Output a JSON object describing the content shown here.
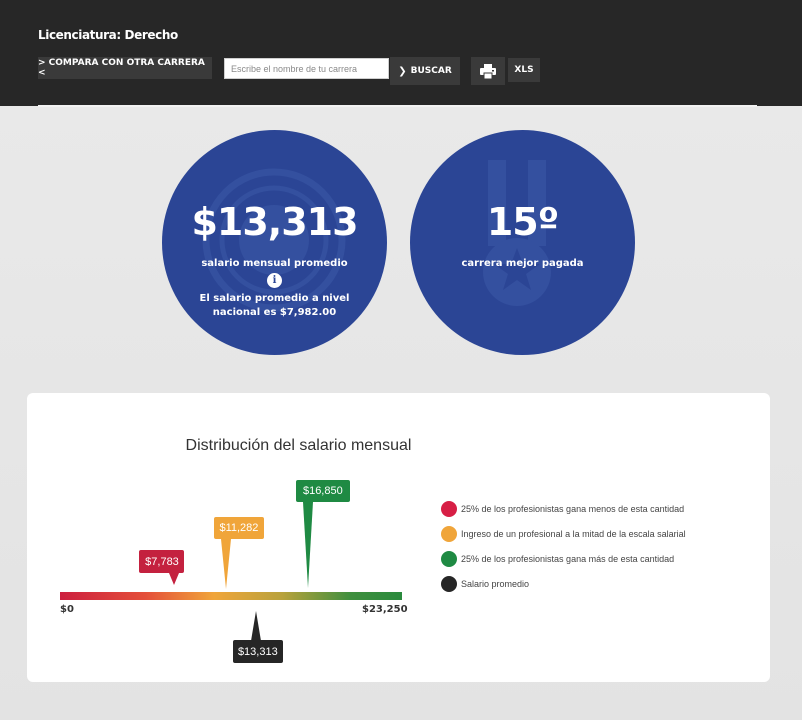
{
  "header": {
    "title": "Licenciatura: Derecho",
    "compare_label": "> COMPARA CON OTRA CARRERA <",
    "search": {
      "placeholder": "Escribe el nombre de tu carrera",
      "value": ""
    },
    "search_button_label": "BUSCAR",
    "print_icon": "printer-icon",
    "xls_label": "XLS"
  },
  "stats": {
    "salary": {
      "value": "$13,313",
      "label": "salario mensual promedio",
      "info_icon": "info-icon",
      "note": "El salario promedio a nivel nacional es $7,982.00",
      "watermark_icon": "coin-icon"
    },
    "rank": {
      "value": "15º",
      "label": "carrera mejor pagada",
      "watermark_icon": "medal-icon"
    }
  },
  "distribution": {
    "title": "Distribución del salario mensual",
    "min_label": "$0",
    "max_label": "$23,250",
    "markers": {
      "q1": {
        "label": "$7,783",
        "value": 7783,
        "color": "#c4213f"
      },
      "median": {
        "label": "$11,282",
        "value": 11282,
        "color": "#f0a53a"
      },
      "q3": {
        "label": "$16,850",
        "value": 16850,
        "color": "#1f8a43"
      },
      "mean": {
        "label": "$13,313",
        "value": 13313,
        "color": "#262626"
      }
    },
    "legend": [
      {
        "text": "25% de los profesionistas gana menos de esta cantidad",
        "color": "#d71f45"
      },
      {
        "text": "Ingreso de un profesional a la mitad de la escala salarial",
        "color": "#f0a53a"
      },
      {
        "text": "25% de los profesionistas gana más de esta cantidad",
        "color": "#1f8a43"
      },
      {
        "text": "Salario promedio",
        "color": "#262626"
      }
    ]
  }
}
